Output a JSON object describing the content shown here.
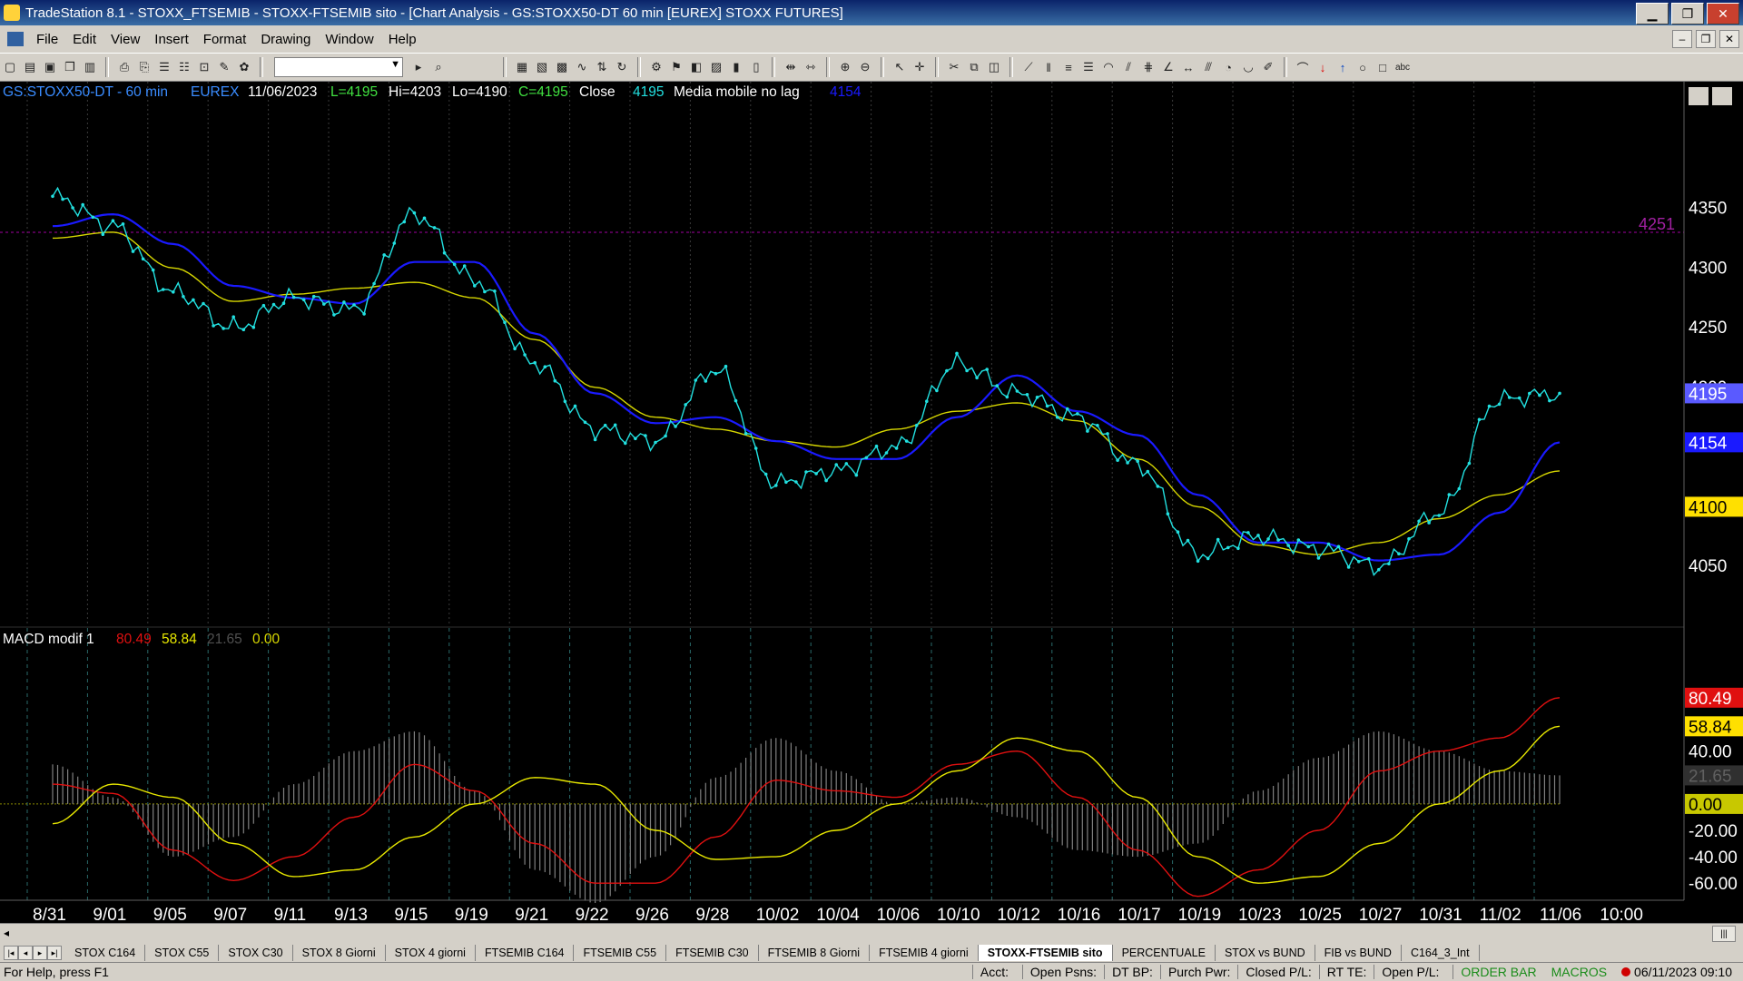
{
  "window": {
    "title": "TradeStation 8.1 - STOXX_FTSEMIB - STOXX-FTSEMIB sito - [Chart Analysis - GS:STOXX50-DT  60 min  [EUREX] STOXX FUTURES]",
    "minimize": "▁",
    "restore": "❐",
    "close": "✕"
  },
  "menu": {
    "items": [
      "File",
      "Edit",
      "View",
      "Insert",
      "Format",
      "Drawing",
      "Window",
      "Help"
    ],
    "mdi_min": "–",
    "mdi_restore": "❐",
    "mdi_close": "✕"
  },
  "toolbar": {
    "combo_value": ""
  },
  "chart": {
    "header": {
      "symbol": "GS:STOXX50-DT - 60 min",
      "exchange": "EUREX",
      "date": "11/06/2023",
      "last": "L=4195",
      "high": "Hi=4203",
      "low": "Lo=4190",
      "close": "C=4195",
      "series": "Close",
      "close_value": "4195",
      "indicator": "Media mobile no lag",
      "indicator_value": "4154"
    },
    "price_axis": [
      "4350",
      "4300",
      "4250",
      "4200",
      "4100",
      "4050"
    ],
    "price_tags": {
      "last": "4195",
      "average": "4154",
      "level_4100": "4100",
      "line_label": "4251"
    },
    "macd": {
      "title": "MACD modif 1",
      "macd": "80.49",
      "signal": "58.84",
      "hist": "21.65",
      "zero": "0.00",
      "axis": [
        "40.00",
        "-20.00",
        "-40.00",
        "-60.00"
      ]
    },
    "date_axis": [
      "8/31",
      "9/01",
      "9/05",
      "9/07",
      "9/11",
      "9/13",
      "9/15",
      "9/19",
      "9/21",
      "9/22",
      "9/26",
      "9/28",
      "10/02",
      "10/04",
      "10/06",
      "10/10",
      "10/12",
      "10/16",
      "10/17",
      "10/19",
      "10/23",
      "10/25",
      "10/27",
      "10/31",
      "11/02",
      "11/06",
      "10:00"
    ],
    "colors": {
      "background": "#000000",
      "price": "#22e0e0",
      "average_fast": "#1a1aff",
      "average_slow": "#d6d600",
      "macd": "#e01010",
      "signal": "#e8e800",
      "histogram": "#808080"
    }
  },
  "chart_data": [
    {
      "type": "line",
      "x": [
        "8/31",
        "9/01",
        "9/05",
        "9/07",
        "9/11",
        "9/13",
        "9/15",
        "9/19",
        "9/21",
        "9/22",
        "9/26",
        "9/28",
        "10/02",
        "10/04",
        "10/06",
        "10/10",
        "10/12",
        "10/16",
        "10/17",
        "10/19",
        "10/23",
        "10/25",
        "10/27",
        "10/31",
        "11/02",
        "11/06"
      ],
      "series": [
        {
          "name": "Close",
          "values": [
            4360,
            4335,
            4280,
            4250,
            4275,
            4265,
            4345,
            4290,
            4220,
            4165,
            4155,
            4215,
            4120,
            4130,
            4150,
            4220,
            4195,
            4175,
            4135,
            4060,
            4075,
            4065,
            4050,
            4095,
            4190,
            4195
          ]
        },
        {
          "name": "Media mobile no lag",
          "values": [
            4335,
            4345,
            4320,
            4285,
            4275,
            4270,
            4305,
            4305,
            4245,
            4195,
            4170,
            4175,
            4155,
            4140,
            4140,
            4175,
            4210,
            4180,
            4160,
            4110,
            4070,
            4070,
            4055,
            4060,
            4095,
            4154
          ]
        },
        {
          "values": [
            4325,
            4330,
            4300,
            4272,
            4278,
            4283,
            4288,
            4275,
            4240,
            4200,
            4175,
            4165,
            4155,
            4150,
            4165,
            4180,
            4187,
            4172,
            4140,
            4100,
            4068,
            4060,
            4070,
            4090,
            4110,
            4130
          ]
        }
      ],
      "ylim": [
        4000,
        4380
      ]
    },
    {
      "type": "line",
      "x": [
        "8/31",
        "9/01",
        "9/05",
        "9/07",
        "9/11",
        "9/13",
        "9/15",
        "9/19",
        "9/21",
        "9/22",
        "9/26",
        "9/28",
        "10/02",
        "10/04",
        "10/06",
        "10/10",
        "10/12",
        "10/16",
        "10/17",
        "10/19",
        "10/23",
        "10/25",
        "10/27",
        "10/31",
        "11/02",
        "11/06"
      ],
      "series": [
        {
          "name": "MACD modif 1",
          "values": [
            15,
            8,
            -35,
            -58,
            -40,
            -10,
            30,
            10,
            -30,
            -60,
            -60,
            -25,
            18,
            10,
            5,
            30,
            40,
            5,
            -35,
            -70,
            -50,
            -20,
            25,
            40,
            50,
            80.49
          ]
        },
        {
          "values": [
            -15,
            15,
            5,
            -30,
            -55,
            -50,
            -25,
            0,
            20,
            15,
            -20,
            -42,
            -40,
            -20,
            0,
            25,
            50,
            40,
            5,
            -40,
            -60,
            -55,
            -30,
            0,
            25,
            58.84
          ]
        },
        {
          "values": [
            30,
            5,
            -40,
            -25,
            15,
            40,
            55,
            10,
            -50,
            -75,
            -40,
            20,
            50,
            25,
            0,
            5,
            -10,
            -35,
            -40,
            -30,
            10,
            35,
            55,
            40,
            25,
            21.65
          ]
        }
      ],
      "ylim": [
        -75,
        90
      ]
    }
  ],
  "tabs": [
    "STOX C164",
    "STOX C55",
    "STOX  C30",
    "STOX  8 Giorni",
    "STOX 4 giorni",
    "FTSEMIB C164",
    "FTSEMIB C55",
    "FTSEMIB C30",
    "FTSEMIB  8 Giorni",
    "FTSEMIB  4 giorni",
    "STOXX-FTSEMIB sito",
    "PERCENTUALE",
    "STOX vs BUND",
    "FIB vs BUND",
    "C164_3_Int"
  ],
  "active_tab": "STOXX-FTSEMIB sito",
  "status": {
    "help": "For Help, press F1",
    "acct": "Acct:",
    "open_psns": "Open Psns:",
    "dt_bp": "DT BP:",
    "purch_pwr": "Purch Pwr:",
    "closed_pl": "Closed P/L:",
    "rt_te": "RT TE:",
    "open_pl": "Open P/L:",
    "order_bar": "ORDER BAR",
    "macros": "MACROS",
    "datetime": "06/11/2023 09:10"
  }
}
